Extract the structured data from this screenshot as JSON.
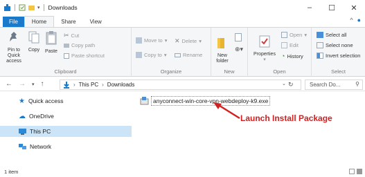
{
  "window": {
    "title": "Downloads"
  },
  "tabs": [
    "File",
    "Home",
    "Share",
    "View"
  ],
  "ribbon": {
    "clipboard": {
      "label": "Clipboard",
      "pin": "Pin to Quick access",
      "copy": "Copy",
      "paste": "Paste",
      "cut": "Cut",
      "copy_path": "Copy path",
      "paste_shortcut": "Paste shortcut"
    },
    "organize": {
      "label": "Organize",
      "move_to": "Move to",
      "copy_to": "Copy to",
      "delete": "Delete",
      "rename": "Rename"
    },
    "new": {
      "label": "New",
      "new_folder": "New folder"
    },
    "open": {
      "label": "Open",
      "properties": "Properties",
      "open": "Open",
      "edit": "Edit",
      "history": "History"
    },
    "select": {
      "label": "Select",
      "select_all": "Select all",
      "select_none": "Select none",
      "invert": "Invert selection"
    }
  },
  "address": {
    "path": [
      "This PC",
      "Downloads"
    ],
    "search_placeholder": "Search Do..."
  },
  "nav": {
    "items": [
      "Quick access",
      "OneDrive",
      "This PC",
      "Network"
    ],
    "selected": "This PC"
  },
  "files": [
    {
      "name": "anyconnect-win-core-vpn-webdeploy-k9.exe"
    }
  ],
  "annotation": {
    "text": "Launch Install Package",
    "color": "#d22020"
  },
  "status": {
    "count": "1 item"
  },
  "colors": {
    "accent": "#1979ca",
    "selected_bg": "#cce4f7",
    "folder": "#f4c542"
  }
}
